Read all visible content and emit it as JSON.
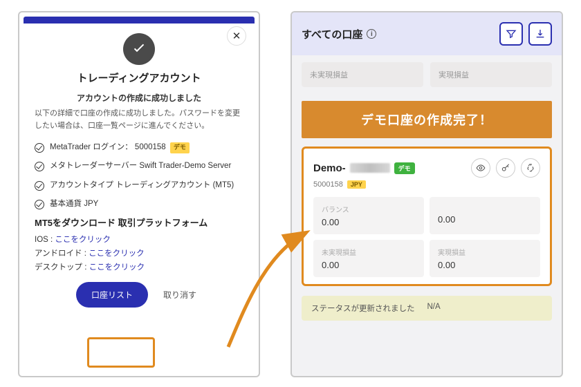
{
  "left": {
    "title": "トレーディングアカウント",
    "subtitle": "アカウントの作成に成功しました",
    "description": "以下の詳細で口座の作成に成功しました。パスワードを変更したい場合は、口座一覧ページに進んでください。",
    "details": {
      "login_label": "MetaTrader ログイン：",
      "login_value": "5000158",
      "login_badge": "デモ",
      "server": "メタトレーダーサーバー Swift Trader-Demo Server",
      "acct_type": "アカウントタイプ トレーディングアカウント (MT5)",
      "currency": "基本通貨 JPY"
    },
    "download_heading": "MT5をダウンロード 取引プラットフォーム",
    "dl_ios_label": "IOS :",
    "dl_android_label": "アンドロイド :",
    "dl_desktop_label": "デスクトップ :",
    "dl_link_text": "ここをクリック",
    "primary_btn": "口座リスト",
    "cancel_btn": "取り消す"
  },
  "right": {
    "header_title": "すべての口座",
    "top_cells": {
      "unrealized": "未実現損益",
      "realized": "実現損益"
    },
    "banner": "デモ口座の作成完了！",
    "account": {
      "name_prefix": "Demo-",
      "badge": "デモ",
      "id": "5000158",
      "ccy": "JPY",
      "balance_label": "バランス",
      "balance_value": "0.00",
      "col2_value": "0.00",
      "unreal_label": "未実現損益",
      "unreal_value": "0.00",
      "real_label": "実現損益",
      "real_value": "0.00"
    },
    "status_label": "ステータスが更新されました",
    "status_value": "N/A"
  }
}
